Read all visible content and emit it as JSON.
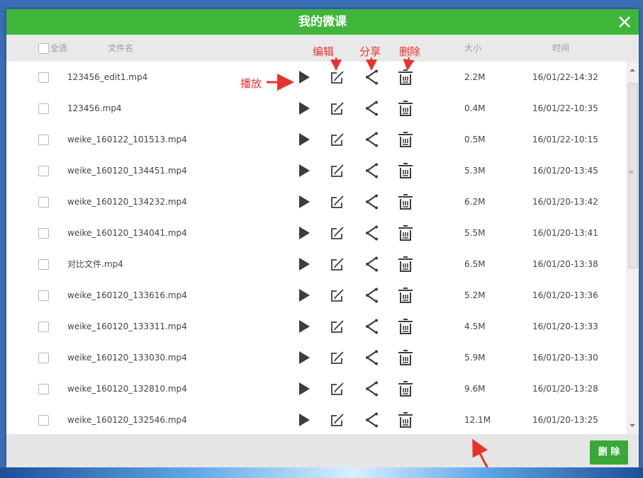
{
  "dialog": {
    "title": "我的微课",
    "close_icon": "close-icon"
  },
  "header": {
    "select_all": "全选",
    "filename": "文件名",
    "size": "大小",
    "time": "时间"
  },
  "annotations": {
    "edit": "编辑",
    "share": "分享",
    "delete": "删除",
    "play": "播放"
  },
  "files": [
    {
      "name": "123456_edit1.mp4",
      "size": "2.2M",
      "time": "16/01/22-14:32"
    },
    {
      "name": "123456.mp4",
      "size": "0.4M",
      "time": "16/01/22-10:35"
    },
    {
      "name": "weike_160122_101513.mp4",
      "size": "0.5M",
      "time": "16/01/22-10:15"
    },
    {
      "name": "weike_160120_134451.mp4",
      "size": "5.3M",
      "time": "16/01/20-13:45"
    },
    {
      "name": "weike_160120_134232.mp4",
      "size": "6.2M",
      "time": "16/01/20-13:42"
    },
    {
      "name": "weike_160120_134041.mp4",
      "size": "5.5M",
      "time": "16/01/20-13:41"
    },
    {
      "name": "对比文件.mp4",
      "size": "6.5M",
      "time": "16/01/20-13:38"
    },
    {
      "name": "weike_160120_133616.mp4",
      "size": "5.2M",
      "time": "16/01/20-13:36"
    },
    {
      "name": "weike_160120_133311.mp4",
      "size": "4.5M",
      "time": "16/01/20-13:33"
    },
    {
      "name": "weike_160120_133030.mp4",
      "size": "5.9M",
      "time": "16/01/20-13:30"
    },
    {
      "name": "weike_160120_132810.mp4",
      "size": "9.6M",
      "time": "16/01/20-13:28"
    },
    {
      "name": "weike_160120_132546.mp4",
      "size": "12.1M",
      "time": "16/01/20-13:25"
    }
  ],
  "footer": {
    "delete_button": "删 除"
  },
  "colors": {
    "title_bar": "#3fb63a",
    "annotation": "#e8322e",
    "icon": "#3d3d3d"
  }
}
